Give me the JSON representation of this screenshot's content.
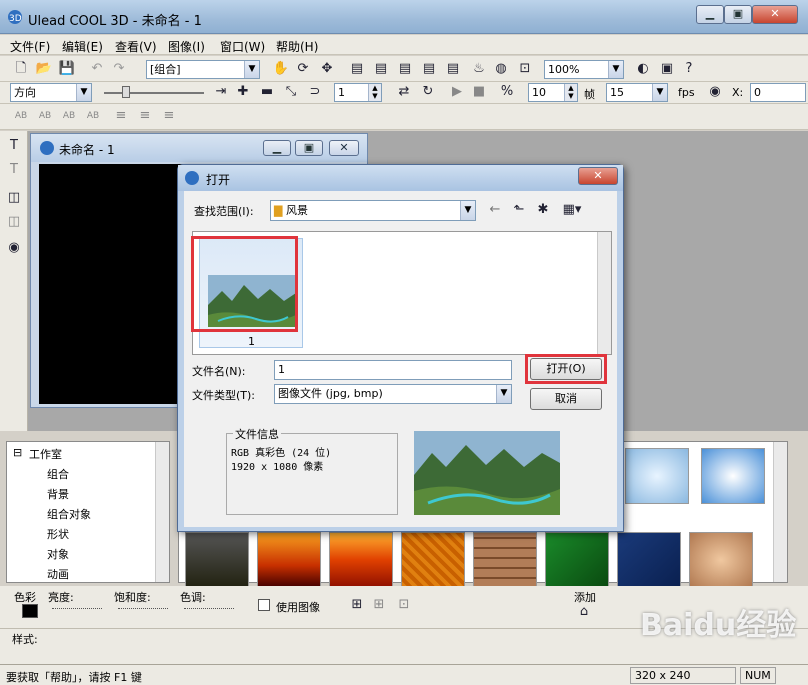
{
  "app": {
    "title": "Ulead COOL 3D - 未命名 - 1"
  },
  "caption_buttons": {
    "minimize": "▁",
    "maximize": "▣",
    "close": "✕"
  },
  "menu": [
    "文件(F)",
    "编辑(E)",
    "查看(V)",
    "图像(I)",
    "窗口(W)",
    "帮助(H)"
  ],
  "toolbar1": {
    "group_combo": "[组合]",
    "zoom_combo": "100%"
  },
  "toolbar2": {
    "direction_combo": "方向",
    "frame_value": "1",
    "fps_value1": "10",
    "frame_label": "帧",
    "fps_value2": "15",
    "fps_label": "fps",
    "x_label": "X:",
    "x_value": "0"
  },
  "doc_window": {
    "title": "未命名 - 1"
  },
  "tree": {
    "root": "工作室",
    "items": [
      "组合",
      "背景",
      "组合对象",
      "形状",
      "对象",
      "动画"
    ]
  },
  "bottom": {
    "color_label": "色彩",
    "brightness_label": "亮度:",
    "saturation_label": "饱和度:",
    "hue_label": "色调:",
    "use_image_label": "使用图像",
    "add_label": "添加",
    "style_label": "样式:"
  },
  "status": {
    "hint": "要获取「帮助」，请按 F1 键",
    "size": "320 x 240",
    "num": "NUM"
  },
  "dialog": {
    "title": "打开",
    "lookin_label": "查找范围(I):",
    "lookin_value": "风景",
    "file_thumb_caption": "1",
    "filename_label": "文件名(N):",
    "filename_value": "1",
    "filetype_label": "文件类型(T):",
    "filetype_value": "图像文件 (jpg, bmp)",
    "open_button": "打开(O)",
    "cancel_button": "取消",
    "info_title": "文件信息",
    "info_line1": "RGB 真彩色 (24 位)",
    "info_line2": "1920 x 1080 像素"
  },
  "watermark": "Baidu经验",
  "colors": {
    "accent_red": "#e0343c",
    "title_blue": "#9ebbd9"
  }
}
